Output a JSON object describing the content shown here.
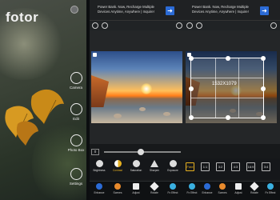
{
  "home": {
    "brand": "fotor",
    "menu": [
      {
        "label": "Camera",
        "icon": "camera-icon"
      },
      {
        "label": "Edit",
        "icon": "edit-icon"
      },
      {
        "label": "Photo Box",
        "icon": "photo-box-icon"
      },
      {
        "label": "Settings",
        "icon": "settings-icon"
      }
    ]
  },
  "ad": {
    "line1": "Power Bank. Now, Recharge Multiple",
    "line2": "Devices Anytime, Anywhere | Inquire!",
    "arrow": "➜"
  },
  "screen1": {
    "slider_value": "0",
    "tools": [
      "Brightness",
      "Contrast",
      "Saturation",
      "Sharpen",
      "Exposure"
    ],
    "bottom": [
      "Enhance",
      "Scenes",
      "Adjust",
      "Rotate",
      "Fx Effect"
    ]
  },
  "screen2": {
    "crop_size": "1532X1079",
    "ratios": [
      "Free",
      "1:1",
      "3:2",
      "4:3",
      "16:9",
      "3:4"
    ],
    "bottom": [
      "Fx Effect",
      "Enhance",
      "Scenes",
      "Adjust",
      "Rotate",
      "Fx Effect"
    ]
  },
  "colors": {
    "accent": "#2b6bd6",
    "selected": "#e6b020"
  }
}
